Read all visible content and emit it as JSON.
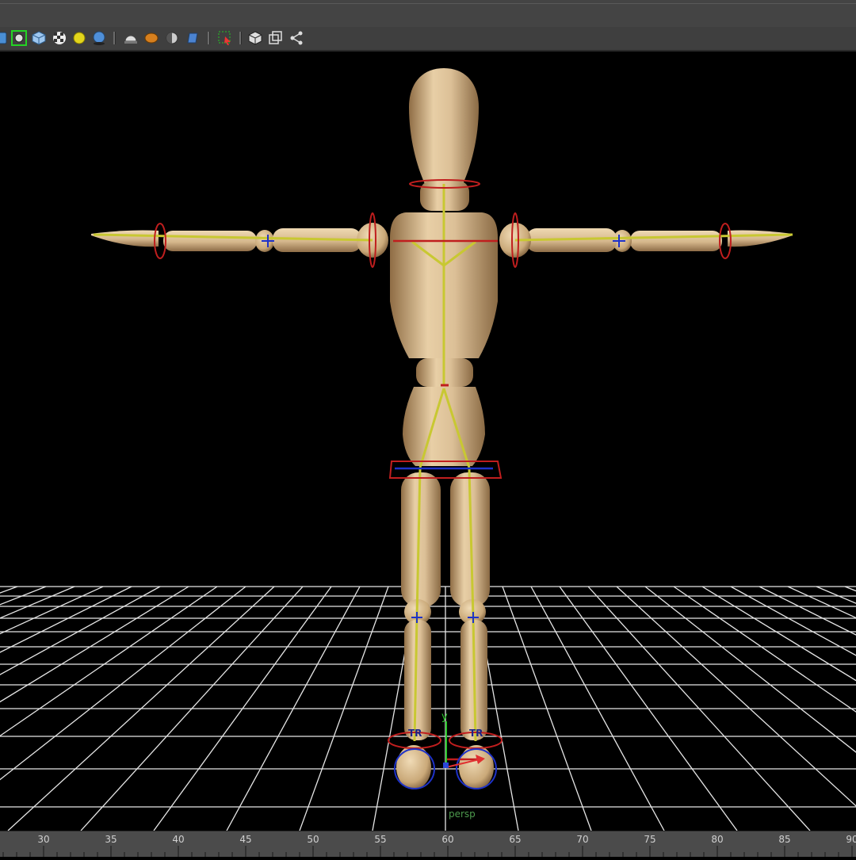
{
  "toolbar": {
    "icons": [
      "camera-icon",
      "isolate-select-icon",
      "wireframe-on-shaded-icon",
      "textured-icon",
      "use-all-lights-icon",
      "shadows-icon",
      "screen-space-ao-icon",
      "motion-blur-icon",
      "multisample-aa-icon",
      "depth-of-field-icon",
      "xray-icon",
      "xray-joints-icon",
      "backface-culling-icon",
      "smooth-wireframe-icon",
      "symmetry-icon"
    ]
  },
  "viewport": {
    "camera_label": "persp",
    "axis_label_y": "y",
    "foot_ik_labels": [
      "TR",
      "TR"
    ]
  },
  "timeline": {
    "ticks": [
      "30",
      "35",
      "40",
      "45",
      "50",
      "55",
      "60",
      "65",
      "70",
      "75",
      "80",
      "85",
      "90"
    ]
  },
  "colors": {
    "background": "#000000",
    "grid": "#e6e6e6",
    "joint": "#c8c832",
    "wood": "#d8b98c",
    "control_red": "#c01e1e",
    "control_blue": "#1e32c8"
  }
}
